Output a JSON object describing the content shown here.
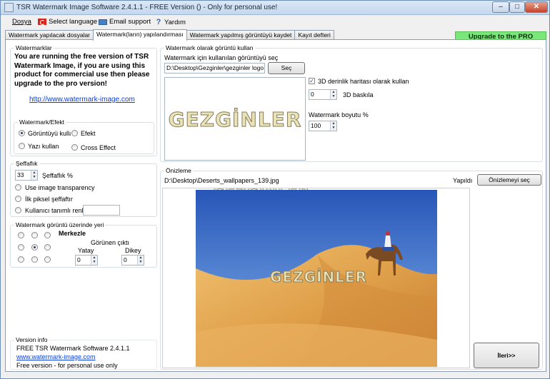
{
  "window": {
    "title": "TSR Watermark Image Software 2.4.1.1 - FREE Version () - Only for personal use!",
    "minimize": "–",
    "maximize": "□",
    "close": "✕"
  },
  "menu": {
    "dosya": "Dosya",
    "language": "Select language",
    "email": "Email support",
    "help": "Yardım",
    "upgrade": "Upgrade to the PRO version"
  },
  "tabs": [
    {
      "label": "Watermark yapılacak dosyalar"
    },
    {
      "label": "Watermark(ların) yapılandırması"
    },
    {
      "label": "Watermark yapılmış görüntüyü kaydet"
    },
    {
      "label": "Kayıt defteri"
    }
  ],
  "watermarks": {
    "legend": "Watermarklar",
    "notice": "You are running the free version of TSR Watermark Image, if you are using this product for commercial use then please upgrade to the pro version!",
    "url": "http://www.watermark-image.com"
  },
  "effect": {
    "legend": "Watermark/Efekt",
    "opt_image": "Görüntüyü kullan",
    "opt_effect": "Efekt",
    "opt_text": "Yazı kullan",
    "opt_cross": "Cross Effect"
  },
  "transparency": {
    "legend": "Şeffaflık",
    "value": "33",
    "label": "Şeffaflık %",
    "opt_image": "Use image transparency",
    "opt_first": "İlk piksel şeffaftır",
    "opt_custom": "Kullanıcı tanımlı renk"
  },
  "position": {
    "legend": "Watermark görüntü üzerinde yeri",
    "center": "Merkezle",
    "offset": "Görünen çıktı",
    "horizontal": "Yatay",
    "vertical": "Dikey",
    "h_value": "0",
    "v_value": "0"
  },
  "version": {
    "legend": "Version info",
    "name": "FREE TSR Watermark Software 2.4.1.1",
    "url": "www.watermark-image.com",
    "note": "Free version - for personal use only"
  },
  "use_watermark": {
    "legend": "Watermark olarak görüntü kullan",
    "select_label": "Watermark için kullanılan görüntüyü seç",
    "path": "D:\\Desktop\\Gezginler\\gezginler logo",
    "browse": "Seç",
    "depth_map": "3D derinlik haritası olarak kullan",
    "depth_value": "0",
    "depth_label": "3D baskıla",
    "size_label": "Watermark boyutu %",
    "size_value": "100",
    "logo_text": "GEZGİNLER"
  },
  "preview": {
    "legend": "Önizleme",
    "path": "D:\\Desktop\\Deserts_wallpapers_139.jpg",
    "done": "Yapıldı",
    "select": "Önizlemeyi seç",
    "next": "İleri>>"
  },
  "colors": {
    "upgrade_bg": "#7ae77a",
    "link": "#0b3fd8",
    "sky": "#3f6fc4",
    "sand": "#e0a04a"
  }
}
